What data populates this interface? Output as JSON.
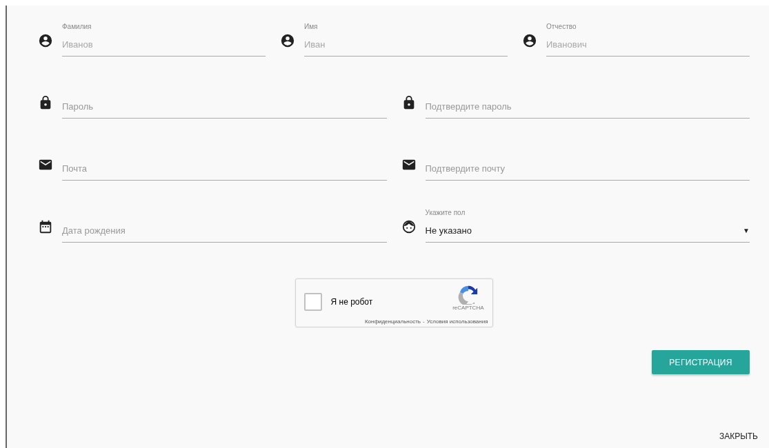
{
  "rows": [
    {
      "fields": [
        {
          "kind": "text",
          "label": "Фамилия",
          "placeholder": "Иванов"
        },
        {
          "kind": "text",
          "label": "Имя",
          "placeholder": "Иван"
        },
        {
          "kind": "text",
          "label": "Отчество",
          "placeholder": "Иванович"
        }
      ]
    },
    {
      "fields": [
        {
          "kind": "text",
          "placeholder": "Пароль"
        },
        {
          "kind": "text",
          "placeholder": "Подтвердите пароль"
        }
      ]
    },
    {
      "fields": [
        {
          "kind": "text",
          "placeholder": "Почта"
        },
        {
          "kind": "text",
          "placeholder": "Подтвердите почту"
        }
      ]
    },
    {
      "fields": [
        {
          "kind": "text",
          "placeholder": "Дата рождения"
        },
        {
          "kind": "select",
          "label": "Укажите пол",
          "value": "Не указано",
          "arrow": "▼"
        }
      ]
    }
  ],
  "captcha": {
    "checked": false,
    "label": "Я не робот",
    "brand": "reCAPTCHA",
    "privacy": "Конфиденциальность",
    "separator": "-",
    "terms": "Условия использования"
  },
  "register_button": "РЕГИСТРАЦИЯ",
  "close_button": "ЗАКРЫТЬ"
}
